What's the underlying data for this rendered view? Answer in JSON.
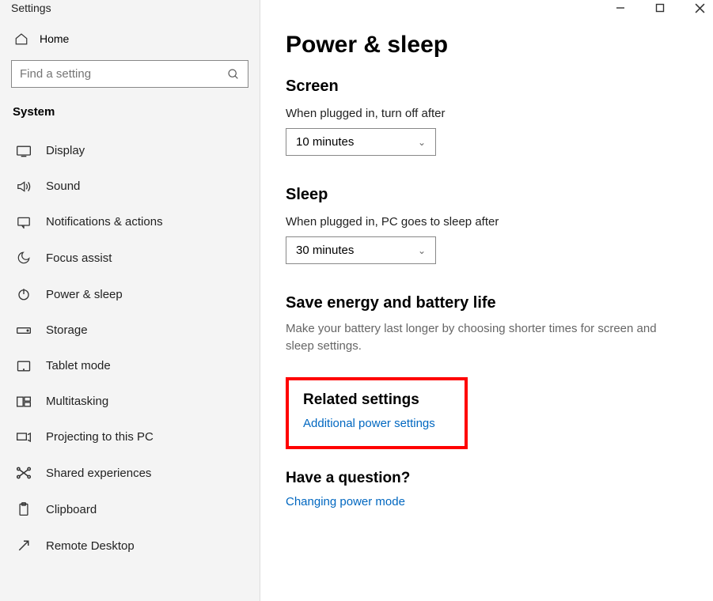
{
  "app_title": "Settings",
  "sidebar": {
    "home_label": "Home",
    "search_placeholder": "Find a setting",
    "category_label": "System",
    "items": [
      {
        "icon": "display",
        "label": "Display"
      },
      {
        "icon": "sound",
        "label": "Sound"
      },
      {
        "icon": "notifications",
        "label": "Notifications & actions"
      },
      {
        "icon": "focus",
        "label": "Focus assist"
      },
      {
        "icon": "power",
        "label": "Power & sleep"
      },
      {
        "icon": "storage",
        "label": "Storage"
      },
      {
        "icon": "tablet",
        "label": "Tablet mode"
      },
      {
        "icon": "multitask",
        "label": "Multitasking"
      },
      {
        "icon": "projecting",
        "label": "Projecting to this PC"
      },
      {
        "icon": "shared",
        "label": "Shared experiences"
      },
      {
        "icon": "clipboard",
        "label": "Clipboard"
      },
      {
        "icon": "remote",
        "label": "Remote Desktop"
      }
    ]
  },
  "content": {
    "page_title": "Power & sleep",
    "screen": {
      "heading": "Screen",
      "label": "When plugged in, turn off after",
      "value": "10 minutes"
    },
    "sleep": {
      "heading": "Sleep",
      "label": "When plugged in, PC goes to sleep after",
      "value": "30 minutes"
    },
    "energy": {
      "heading": "Save energy and battery life",
      "desc": "Make your battery last longer by choosing shorter times for screen and sleep settings."
    },
    "related": {
      "heading": "Related settings",
      "link": "Additional power settings"
    },
    "question": {
      "heading": "Have a question?",
      "link": "Changing power mode"
    }
  }
}
